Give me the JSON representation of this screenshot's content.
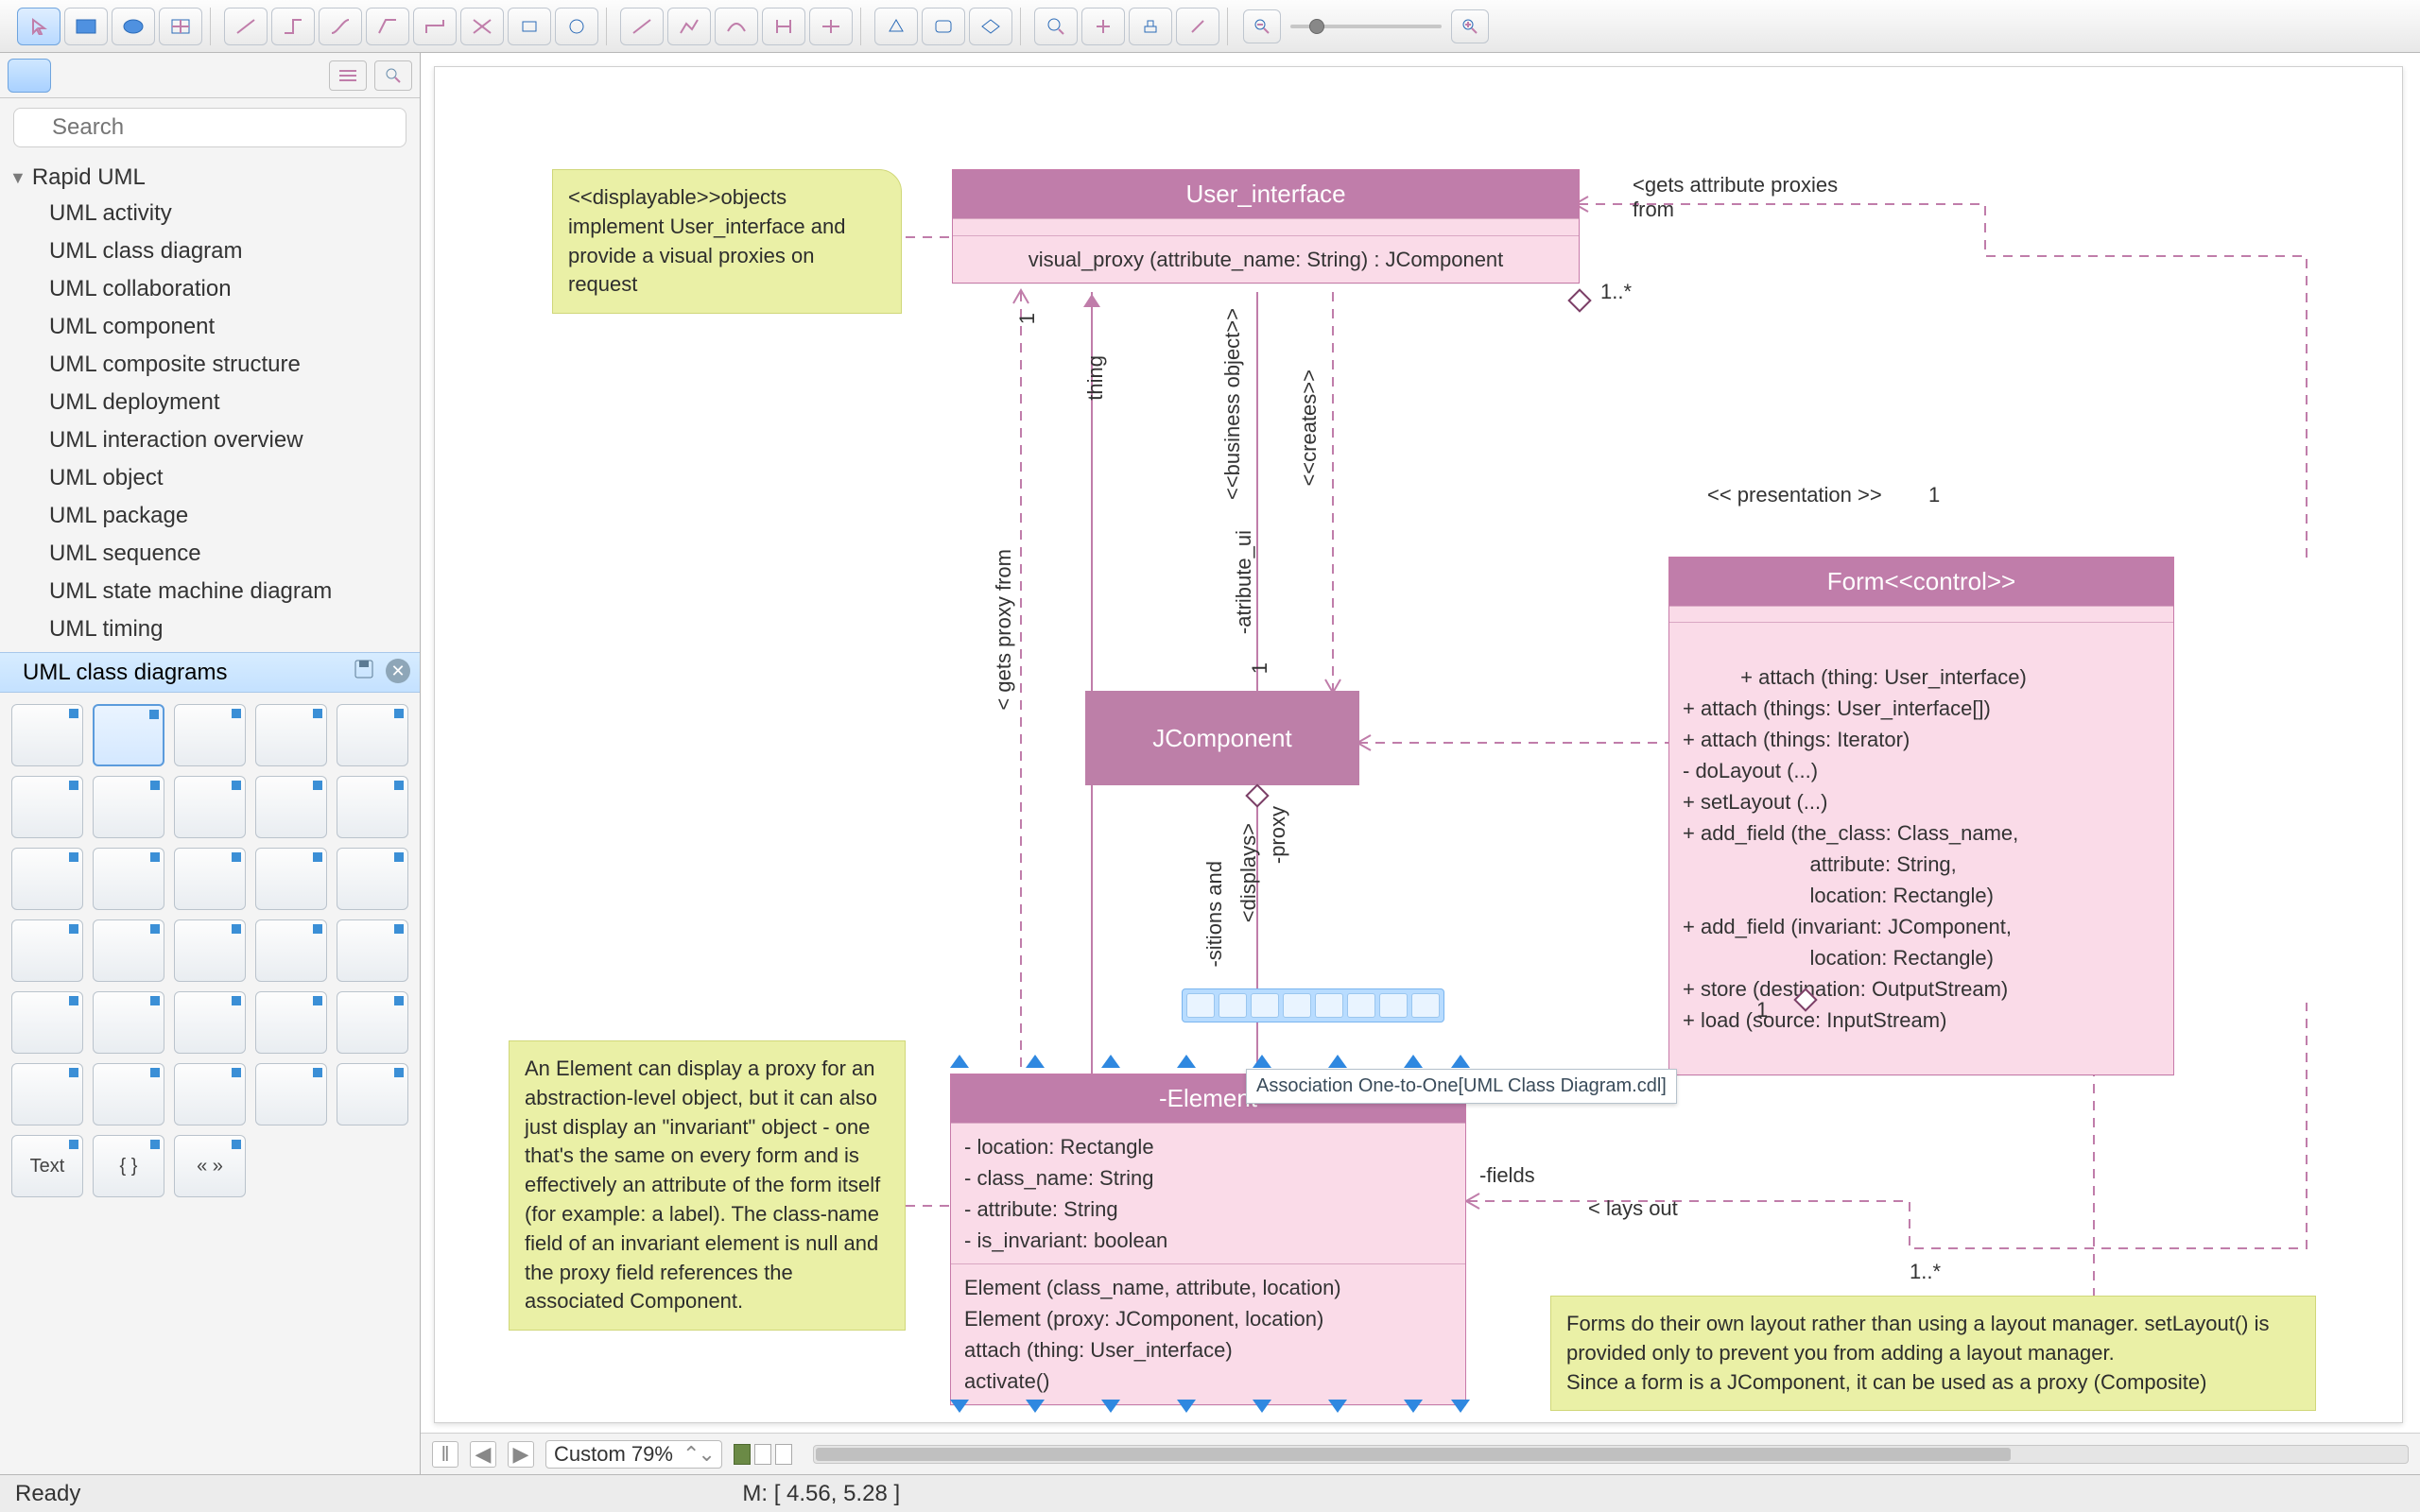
{
  "search": {
    "placeholder": "Search"
  },
  "tree": {
    "header": "Rapid UML",
    "items": [
      "UML activity",
      "UML class diagram",
      "UML collaboration",
      "UML component",
      "UML composite structure",
      "UML deployment",
      "UML interaction overview",
      "UML object",
      "UML package",
      "UML sequence",
      "UML state machine diagram",
      "UML timing"
    ]
  },
  "section": {
    "title": "UML class diagrams"
  },
  "stencil_text": {
    "text": "Text",
    "braces": "{  }",
    "arrows": "«  »"
  },
  "canvas": {
    "user_interface": {
      "title": "User_interface",
      "op": "visual_proxy (attribute_name: String) : JComponent"
    },
    "jcomponent": {
      "title": "JComponent"
    },
    "form": {
      "title": "Form<<control>>",
      "ops": "+ attach (thing: User_interface)\n+ attach (things: User_interface[])\n+ attach (things: Iterator)\n- doLayout (...)\n+ setLayout (...)\n+ add_field (the_class: Class_name,\n                      attribute: String,\n                      location: Rectangle)\n+ add_field (invariant: JComponent,\n                      location: Rectangle)\n+ store (destination: OutputStream)\n+ load (source: InputStream)"
    },
    "element": {
      "title": "-Element",
      "attrs": "- location: Rectangle\n- class_name: String\n- attribute: String\n- is_invariant: boolean",
      "ops2": "Element (class_name, attribute, location)\nElement (proxy: JComponent, location)\nattach (thing: User_interface)\nactivate()"
    },
    "labels": {
      "displayable_note": "<<displayable>>objects\nimplement User_interface and\nprovide a visual proxies on\nrequest",
      "element_note": "An Element can display a proxy for an abstraction-level object, but it can also just display an \"invariant\" object - one that's the same on every form and is effectively an attribute of the form itself (for example: a label). The class-name field of an invariant element is null and the proxy field references the associated Component.",
      "form_note": "Forms do their own layout rather than using a layout manager. setLayout() is provided only to prevent you from adding a layout manager.\nSince a form is a JComponent, it can be used as a proxy (Composite)",
      "gets_attr": "<gets attribute proxies\nfrom",
      "one_star": "1..*",
      "one_star_b": "1..*",
      "one_a": "1",
      "one_b": "1",
      "one_c": "1",
      "one_d": "1",
      "thing": "thing",
      "gets_proxy": "< gets proxy from",
      "business": "<<business object>>",
      "atribute_ui": "-atribute_ui",
      "creates": "<<creates>>",
      "presentation": "<< presentation >>",
      "proxy": "-proxy",
      "displays": "<displays>",
      "positions_and": "-sitions and",
      "fields": "-fields",
      "lays_out": "< lays out",
      "tooltip": "Association One-to-One[UML Class Diagram.cdl]"
    }
  },
  "footer": {
    "zoom": "Custom 79%",
    "pos": "M: [ 4.56, 5.28 ]"
  },
  "status": {
    "ready": "Ready"
  }
}
